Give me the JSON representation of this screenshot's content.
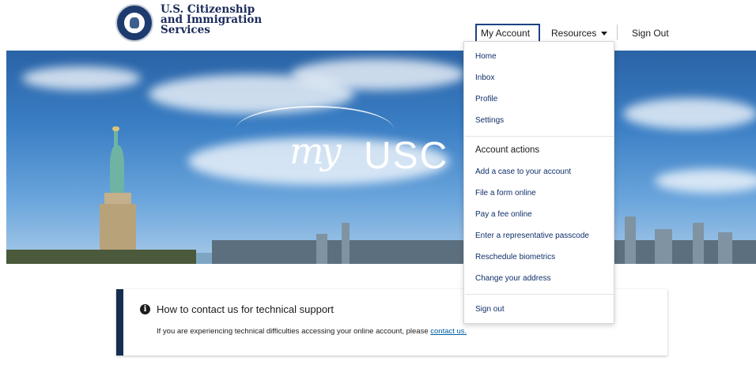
{
  "header": {
    "agency_lines": [
      "U.S. Citizenship",
      "and Immigration",
      "Services"
    ],
    "nav": {
      "my_account": "My Account",
      "resources": "Resources",
      "sign_out": "Sign Out"
    }
  },
  "hero": {
    "logo_script": "my",
    "logo_text": "USC"
  },
  "dropdown": {
    "items": [
      "Home",
      "Inbox",
      "Profile",
      "Settings"
    ],
    "actions_heading": "Account actions",
    "actions": [
      "Add a case to your account",
      "File a form online",
      "Pay a fee online",
      "Enter a representative passcode",
      "Reschedule biometrics",
      "Change your address"
    ],
    "sign_out": "Sign out"
  },
  "alert": {
    "icon": "info-icon",
    "icon_glyph": "i",
    "title": "How to contact us for technical support",
    "body": "If you are experiencing technical difficulties accessing your online account, please ",
    "link": "contact us."
  },
  "colors": {
    "brand_navy": "#162e51",
    "link_blue": "#005ea2",
    "menu_text": "#0f2f6a"
  }
}
